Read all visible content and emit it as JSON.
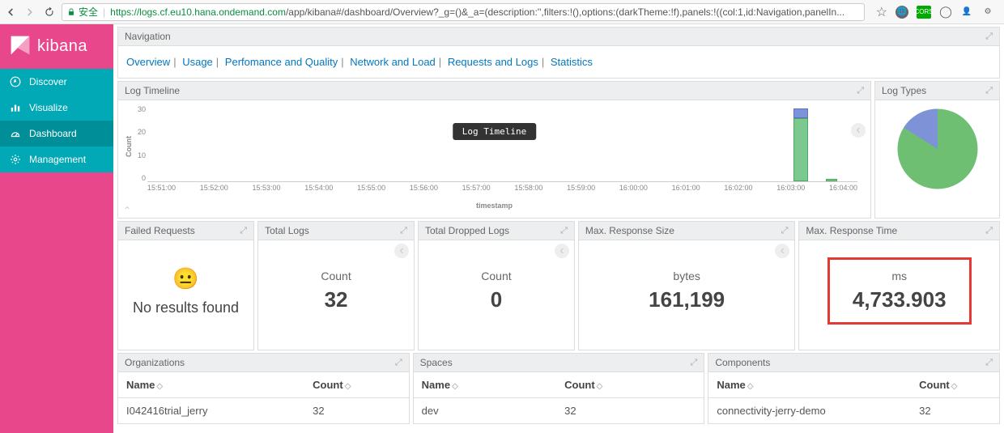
{
  "browser": {
    "secure_label": "安全",
    "host": "https://logs.cf.eu10.hana.ondemand.com",
    "path": "/app/kibana#/dashboard/Overview?_g=()&_a=(description:'',filters:!(),options:(darkTheme:!f),panels:!((col:1,id:Navigation,panelIn..."
  },
  "sidebar": {
    "brand": "kibana",
    "items": [
      {
        "label": "Discover"
      },
      {
        "label": "Visualize"
      },
      {
        "label": "Dashboard"
      },
      {
        "label": "Management"
      }
    ]
  },
  "nav_panel": {
    "title": "Navigation",
    "links": [
      "Overview",
      "Usage",
      "Perfomance and Quality",
      "Network and Load",
      "Requests and Logs",
      "Statistics"
    ]
  },
  "timeline": {
    "title": "Log Timeline",
    "tooltip": "Log Timeline",
    "ylabel": "Count",
    "xlabel": "timestamp",
    "yticks": [
      "30",
      "20",
      "10",
      "0"
    ],
    "xticks": [
      "15:51:00",
      "15:52:00",
      "15:53:00",
      "15:54:00",
      "15:55:00",
      "15:56:00",
      "15:57:00",
      "15:58:00",
      "15:59:00",
      "16:00:00",
      "16:01:00",
      "16:02:00",
      "16:03:00",
      "16:04:00"
    ]
  },
  "logtypes": {
    "title": "Log Types"
  },
  "metrics": {
    "failed": {
      "title": "Failed Requests",
      "msg": "No results found"
    },
    "total_logs": {
      "title": "Total Logs",
      "label": "Count",
      "value": "32"
    },
    "dropped": {
      "title": "Total Dropped Logs",
      "label": "Count",
      "value": "0"
    },
    "resp_size": {
      "title": "Max. Response Size",
      "label": "bytes",
      "value": "161,199"
    },
    "resp_time": {
      "title": "Max. Response Time",
      "label": "ms",
      "value": "4,733.903"
    }
  },
  "tables": {
    "orgs": {
      "title": "Organizations",
      "cols": [
        "Name",
        "Count"
      ],
      "row": [
        "I042416trial_jerry",
        "32"
      ]
    },
    "spaces": {
      "title": "Spaces",
      "cols": [
        "Name",
        "Count"
      ],
      "row": [
        "dev",
        "32"
      ]
    },
    "components": {
      "title": "Components",
      "cols": [
        "Name",
        "Count"
      ],
      "row": [
        "connectivity-jerry-demo",
        "32"
      ]
    }
  },
  "chart_data": [
    {
      "type": "bar",
      "title": "Log Timeline",
      "xlabel": "timestamp",
      "ylabel": "Count",
      "ylim": [
        0,
        30
      ],
      "categories": [
        "15:51:00",
        "15:52:00",
        "15:53:00",
        "15:54:00",
        "15:55:00",
        "15:56:00",
        "15:57:00",
        "15:58:00",
        "15:59:00",
        "16:00:00",
        "16:01:00",
        "16:02:00",
        "16:03:00",
        "16:04:00"
      ],
      "series": [
        {
          "name": "green",
          "values": [
            0,
            0,
            0,
            0,
            0,
            0,
            0,
            0,
            0,
            0,
            0,
            0,
            0,
            27
          ]
        },
        {
          "name": "blue",
          "values": [
            0,
            0,
            0,
            0,
            0,
            0,
            0,
            0,
            0,
            0,
            0,
            0,
            0,
            4
          ]
        }
      ],
      "annotations": [
        {
          "x_after": "16:04:00",
          "series": "green",
          "value": 1
        }
      ]
    },
    {
      "type": "pie",
      "title": "Log Types",
      "series": [
        {
          "name": "green",
          "value": 82
        },
        {
          "name": "blue",
          "value": 18
        }
      ]
    }
  ]
}
